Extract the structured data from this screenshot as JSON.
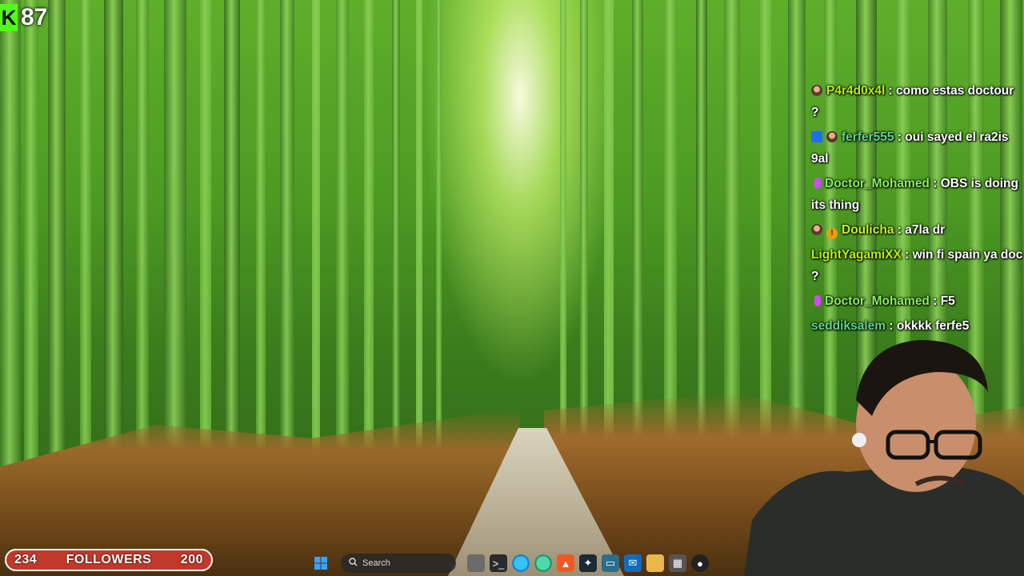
{
  "stream": {
    "platform_logo": "K",
    "viewer_count": "87"
  },
  "chat": {
    "messages": [
      {
        "user": "P4r4d0x4l",
        "user_color": "#b9f20a",
        "badges": [
          "avatar"
        ],
        "text": "como estas doctour ?"
      },
      {
        "user": "ferfer555",
        "user_color": "#5fd38d",
        "badges": [
          "mod",
          "avatar"
        ],
        "text": "oui sayed el ra2is 9al"
      },
      {
        "user": "Doctor_Mohamed",
        "user_color": "#89f05a",
        "badges": [
          "vip"
        ],
        "text": "OBS is doing its thing"
      },
      {
        "user": "Doulicha",
        "user_color": "#c5f32a",
        "badges": [
          "avatar",
          "gift"
        ],
        "text": "a7la dr"
      },
      {
        "user": "LightYagamiXX",
        "user_color": "#b9f20a",
        "badges": [],
        "text": "win fi spain ya doc ?"
      },
      {
        "user": "Doctor_Mohamed",
        "user_color": "#89f05a",
        "badges": [
          "vip"
        ],
        "text": "F5"
      },
      {
        "user": "seddiksalem",
        "user_color": "#5fd38d",
        "badges": [],
        "text": "okkkk ferfe5"
      }
    ]
  },
  "followers_goal": {
    "current": "234",
    "label": "FOLLOWERS",
    "target": "200"
  },
  "taskbar": {
    "search_placeholder": "Search",
    "icons": [
      "start-icon",
      "search-icon",
      "file-explorer-icon",
      "terminal-icon",
      "edge-icon",
      "edge-dev-icon",
      "brave-icon",
      "app-icon",
      "monitor-icon",
      "outlook-icon",
      "folder-icon",
      "store-icon",
      "obs-icon"
    ]
  },
  "colors": {
    "kick_green": "#53fc18",
    "followers_bar": "#c0392b"
  }
}
